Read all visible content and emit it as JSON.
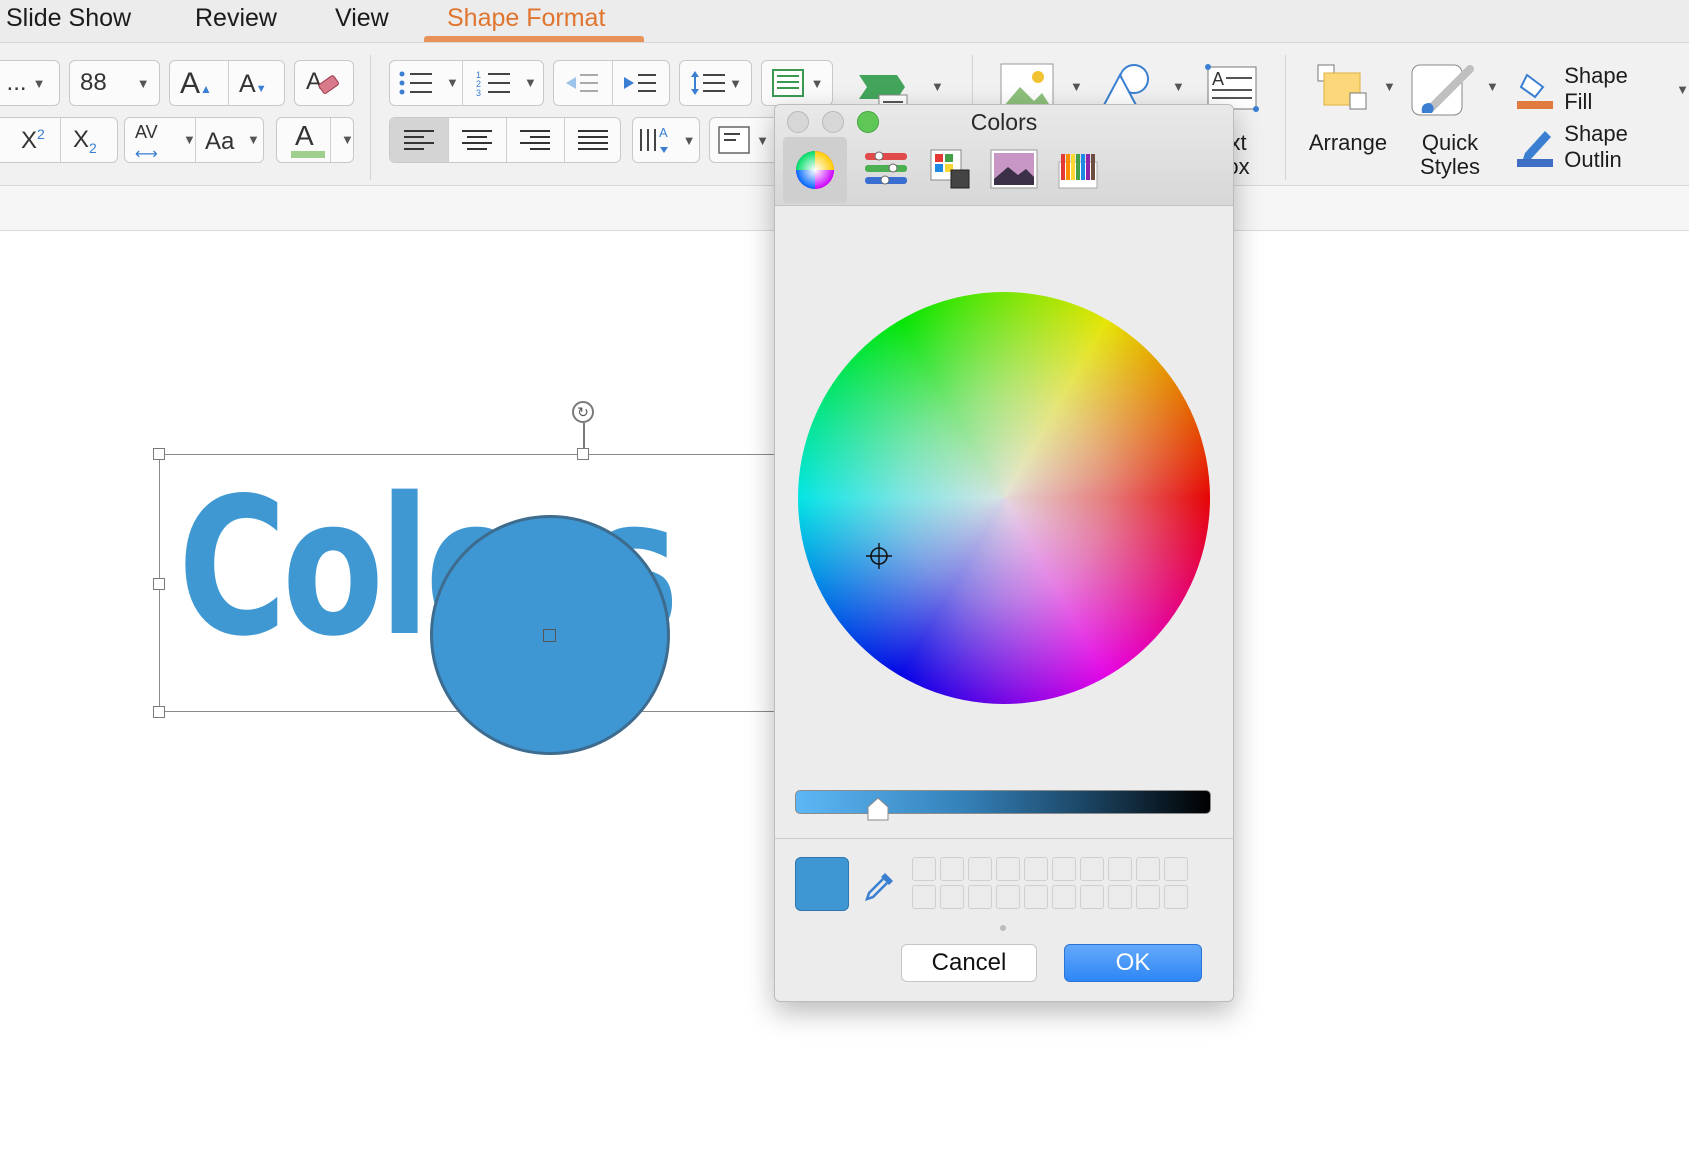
{
  "tabs": [
    {
      "label": "Slide Show"
    },
    {
      "label": "Review"
    },
    {
      "label": "View"
    },
    {
      "label": "Shape Format",
      "active": true
    }
  ],
  "ribbon": {
    "font_name_partial": "...",
    "font_size": "88",
    "grow_font": "A",
    "shrink_font": "A",
    "superscript": "X",
    "superscript_exp": "2",
    "subscript": "X",
    "subscript_exp": "2",
    "char_spacing": "AV",
    "change_case": "Aa",
    "font_color": "A",
    "arrange_label": "Arrange",
    "quick_styles_label_1": "Quick",
    "quick_styles_label_2": "Styles",
    "text_box_label_1": "xt",
    "text_box_label_2": "ox",
    "shape_fill_label": "Shape Fill",
    "shape_outline_label": "Shape Outlin"
  },
  "slide": {
    "wordart_text": "Colors",
    "wordart_color": "#3f98d2",
    "circle_fill": "#3e96d3"
  },
  "colors_panel": {
    "title": "Colors",
    "modes": [
      "color-wheel",
      "color-sliders",
      "color-palettes",
      "image-palettes",
      "pencils"
    ],
    "selected_mode": "color-wheel",
    "brightness_fraction": 0.2,
    "current_color": "#3e96d3",
    "cancel_label": "Cancel",
    "ok_label": "OK"
  }
}
